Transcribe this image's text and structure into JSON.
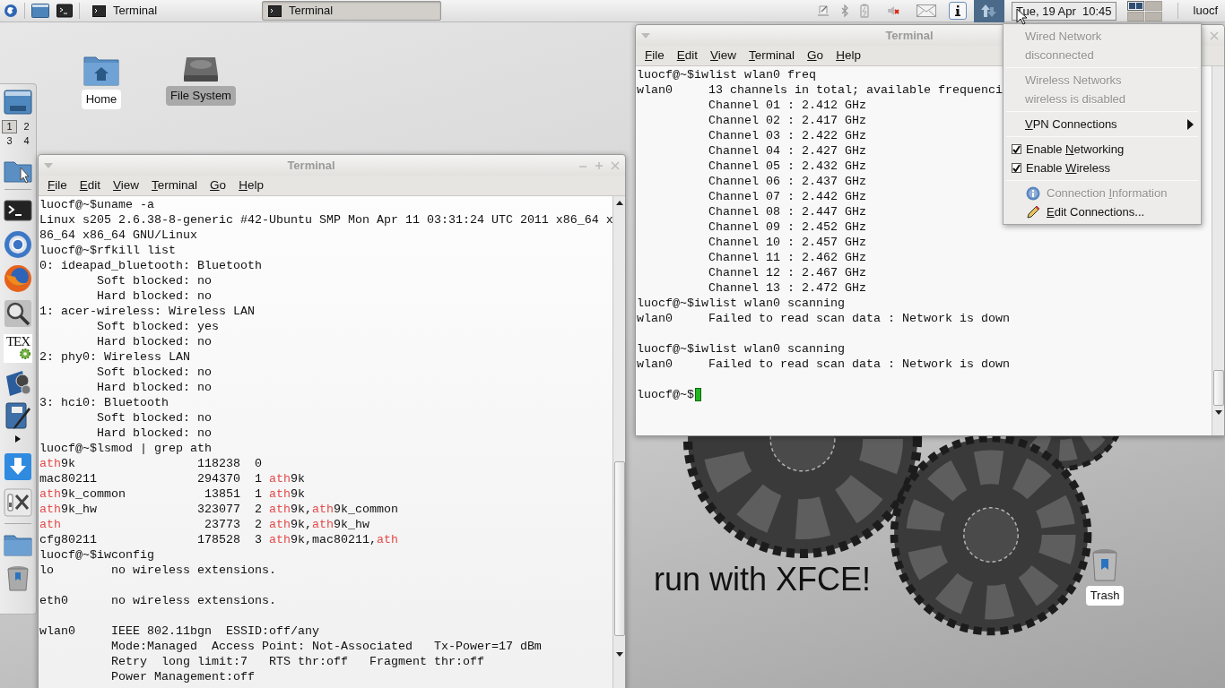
{
  "panel": {
    "taskbar": [
      {
        "label": "Terminal",
        "selected": false
      },
      {
        "label": "Terminal",
        "selected": true
      }
    ],
    "network_button": {
      "selected": true
    },
    "clock": "Tue, 19 Apr  10:45",
    "pager": [
      {
        "selected": true
      },
      {
        "selected": false
      },
      {
        "selected": false
      },
      {
        "selected": false
      }
    ],
    "user": "luocf"
  },
  "dock": {
    "workspaces": [
      {
        "label": "1",
        "selected": true
      },
      {
        "label": "2",
        "selected": false
      },
      {
        "label": "3",
        "selected": false
      },
      {
        "label": "4",
        "selected": false
      }
    ],
    "tex_logo": "TEX"
  },
  "desktop_icons": [
    {
      "label": "Home",
      "selected": false
    },
    {
      "label": "File System",
      "selected": true
    },
    {
      "label": "Trash",
      "selected": false
    }
  ],
  "wallpaper_text": "run with XFCE!",
  "windows": [
    {
      "title": "Terminal",
      "title_buttons": [
        {
          "kind": "minimize"
        },
        {
          "kind": "maximize"
        },
        {
          "kind": "close"
        }
      ],
      "menu": [
        {
          "key": "F",
          "rest": "ile"
        },
        {
          "key": "E",
          "rest": "dit"
        },
        {
          "key": "V",
          "rest": "iew"
        },
        {
          "key": "T",
          "rest": "erminal"
        },
        {
          "key": "G",
          "rest": "o"
        },
        {
          "key": "H",
          "rest": "elp"
        }
      ],
      "lines": [
        {
          "kind": "text",
          "text": "luocf@~$uname -a"
        },
        {
          "kind": "text",
          "text": "Linux s205 2.6.38-8-generic #42-Ubuntu SMP Mon Apr 11 03:31:24 UTC 2011 x86_64 x"
        },
        {
          "kind": "text",
          "text": "86_64 x86_64 GNU/Linux"
        },
        {
          "kind": "text",
          "text": "luocf@~$rfkill list"
        },
        {
          "kind": "text",
          "text": "0: ideapad_bluetooth: Bluetooth"
        },
        {
          "kind": "text",
          "text": "        Soft blocked: no"
        },
        {
          "kind": "text",
          "text": "        Hard blocked: no"
        },
        {
          "kind": "text",
          "text": "1: acer-wireless: Wireless LAN"
        },
        {
          "kind": "text",
          "text": "        Soft blocked: yes"
        },
        {
          "kind": "text",
          "text": "        Hard blocked: no"
        },
        {
          "kind": "text",
          "text": "2: phy0: Wireless LAN"
        },
        {
          "kind": "text",
          "text": "        Soft blocked: no"
        },
        {
          "kind": "text",
          "text": "        Hard blocked: no"
        },
        {
          "kind": "text",
          "text": "3: hci0: Bluetooth"
        },
        {
          "kind": "text",
          "text": "        Soft blocked: no"
        },
        {
          "kind": "text",
          "text": "        Hard blocked: no"
        },
        {
          "kind": "text",
          "text": "luocf@~$lsmod | grep ath"
        },
        {
          "kind": "parts",
          "parts": [
            {
              "text": "ath",
              "match": true
            },
            {
              "text": "9k                 118238  0",
              "match": false
            }
          ]
        },
        {
          "kind": "parts",
          "parts": [
            {
              "text": "mac80211              294370  1 ",
              "match": false
            },
            {
              "text": "ath",
              "match": true
            },
            {
              "text": "9k",
              "match": false
            }
          ]
        },
        {
          "kind": "parts",
          "parts": [
            {
              "text": "ath",
              "match": true
            },
            {
              "text": "9k_common           13851  1 ",
              "match": false
            },
            {
              "text": "ath",
              "match": true
            },
            {
              "text": "9k",
              "match": false
            }
          ]
        },
        {
          "kind": "parts",
          "parts": [
            {
              "text": "ath",
              "match": true
            },
            {
              "text": "9k_hw              323077  2 ",
              "match": false
            },
            {
              "text": "ath",
              "match": true
            },
            {
              "text": "9k,",
              "match": false
            },
            {
              "text": "ath",
              "match": true
            },
            {
              "text": "9k_common",
              "match": false
            }
          ]
        },
        {
          "kind": "parts",
          "parts": [
            {
              "text": "ath",
              "match": true
            },
            {
              "text": "                    23773  2 ",
              "match": false
            },
            {
              "text": "ath",
              "match": true
            },
            {
              "text": "9k,",
              "match": false
            },
            {
              "text": "ath",
              "match": true
            },
            {
              "text": "9k_hw",
              "match": false
            }
          ]
        },
        {
          "kind": "parts",
          "parts": [
            {
              "text": "cfg80211              178528  3 ",
              "match": false
            },
            {
              "text": "ath",
              "match": true
            },
            {
              "text": "9k,mac80211,",
              "match": false
            },
            {
              "text": "ath",
              "match": true
            }
          ]
        },
        {
          "kind": "text",
          "text": "luocf@~$iwconfig"
        },
        {
          "kind": "text",
          "text": "lo        no wireless extensions."
        },
        {
          "kind": "blank"
        },
        {
          "kind": "text",
          "text": "eth0      no wireless extensions."
        },
        {
          "kind": "blank"
        },
        {
          "kind": "text",
          "text": "wlan0     IEEE 802.11bgn  ESSID:off/any"
        },
        {
          "kind": "text",
          "text": "          Mode:Managed  Access Point: Not-Associated   Tx-Power=17 dBm"
        },
        {
          "kind": "text",
          "text": "          Retry  long limit:7   RTS thr:off   Fragment thr:off"
        },
        {
          "kind": "text",
          "text": "          Power Management:off"
        }
      ]
    },
    {
      "title": "Terminal",
      "title_buttons": [
        {
          "kind": "close"
        }
      ],
      "menu": [
        {
          "key": "F",
          "rest": "ile"
        },
        {
          "key": "E",
          "rest": "dit"
        },
        {
          "key": "V",
          "rest": "iew"
        },
        {
          "key": "T",
          "rest": "erminal"
        },
        {
          "key": "G",
          "rest": "o"
        },
        {
          "key": "H",
          "rest": "elp"
        }
      ],
      "lines": [
        {
          "kind": "text",
          "text": "luocf@~$iwlist wlan0 freq"
        },
        {
          "kind": "text",
          "text": "wlan0     13 channels in total; available frequenci"
        },
        {
          "kind": "text",
          "text": "          Channel 01 : 2.412 GHz"
        },
        {
          "kind": "text",
          "text": "          Channel 02 : 2.417 GHz"
        },
        {
          "kind": "text",
          "text": "          Channel 03 : 2.422 GHz"
        },
        {
          "kind": "text",
          "text": "          Channel 04 : 2.427 GHz"
        },
        {
          "kind": "text",
          "text": "          Channel 05 : 2.432 GHz"
        },
        {
          "kind": "text",
          "text": "          Channel 06 : 2.437 GHz"
        },
        {
          "kind": "text",
          "text": "          Channel 07 : 2.442 GHz"
        },
        {
          "kind": "text",
          "text": "          Channel 08 : 2.447 GHz"
        },
        {
          "kind": "text",
          "text": "          Channel 09 : 2.452 GHz"
        },
        {
          "kind": "text",
          "text": "          Channel 10 : 2.457 GHz"
        },
        {
          "kind": "text",
          "text": "          Channel 11 : 2.462 GHz"
        },
        {
          "kind": "text",
          "text": "          Channel 12 : 2.467 GHz"
        },
        {
          "kind": "text",
          "text": "          Channel 13 : 2.472 GHz"
        },
        {
          "kind": "text",
          "text": "luocf@~$iwlist wlan0 scanning"
        },
        {
          "kind": "text",
          "text": "wlan0     Failed to read scan data : Network is down"
        },
        {
          "kind": "blank"
        },
        {
          "kind": "text",
          "text": "luocf@~$iwlist wlan0 scanning"
        },
        {
          "kind": "text",
          "text": "wlan0     Failed to read scan data : Network is down"
        },
        {
          "kind": "blank"
        },
        {
          "kind": "prompt",
          "text": "luocf@~$"
        }
      ]
    }
  ],
  "network_menu": {
    "items": [
      {
        "kind": "status",
        "label": "Wired Network",
        "disabled": true
      },
      {
        "kind": "status",
        "label": "disconnected",
        "disabled": true
      },
      {
        "kind": "separator"
      },
      {
        "kind": "status",
        "label": "Wireless Networks",
        "disabled": true
      },
      {
        "kind": "status",
        "label": "wireless is disabled",
        "disabled": true
      },
      {
        "kind": "separator"
      },
      {
        "kind": "submenu",
        "key": "V",
        "rest": "PN Connections",
        "disabled": false
      },
      {
        "kind": "separator"
      },
      {
        "kind": "check",
        "pre": "Enable ",
        "key": "N",
        "rest": "etworking",
        "checked": true,
        "disabled": false
      },
      {
        "kind": "check",
        "pre": "Enable ",
        "key": "W",
        "rest": "ireless",
        "checked": true,
        "disabled": false
      },
      {
        "kind": "separator"
      },
      {
        "kind": "info",
        "pre": "Connection ",
        "key": "I",
        "rest": "nformation",
        "disabled": true
      },
      {
        "kind": "edit",
        "key": "E",
        "rest": "dit Connections...",
        "disabled": false
      }
    ]
  }
}
